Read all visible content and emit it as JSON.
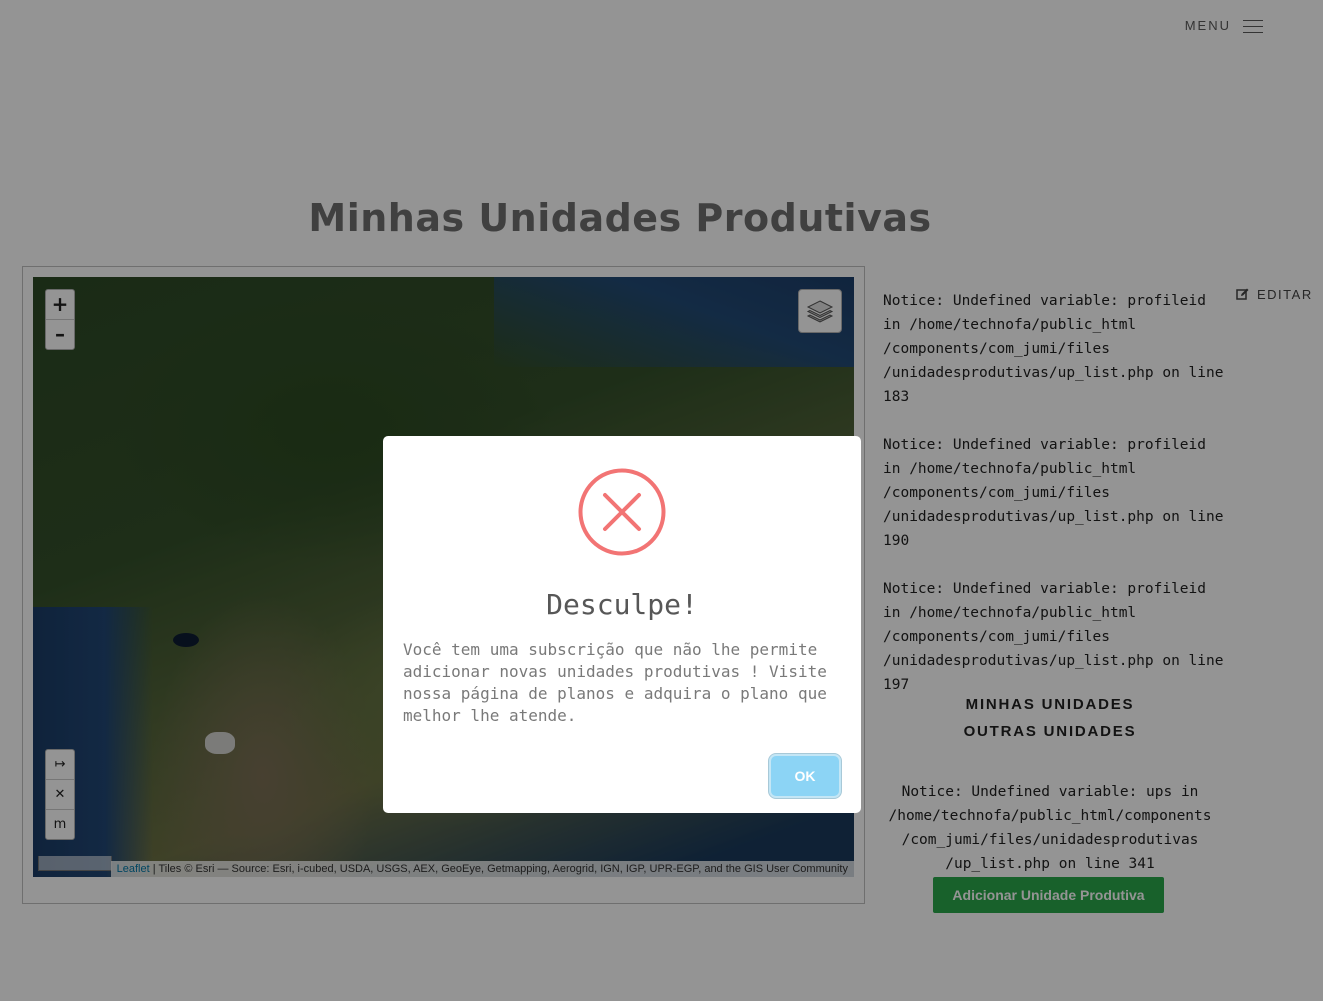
{
  "header": {
    "menu_label": "MENU",
    "menu_icon": "hamburger-icon"
  },
  "page_title": "Minhas Unidades Produtivas",
  "map": {
    "zoom_in": "+",
    "zoom_out": "–",
    "layers_icon": "layers-icon",
    "measure_buttons": [
      "↦",
      "✕",
      "m"
    ],
    "attribution_link": "Leaflet",
    "attribution_text": " | Tiles © Esri — Source: Esri, i-cubed, USDA, USGS, AEX, GeoEye, Getmapping, Aerogrid, IGN, IGP, UPR-EGP, and the GIS User Community"
  },
  "sidebar": {
    "notices": [
      "Notice: Undefined variable: profileid\nin /home/technofa/public_html\n/components/com_jumi/files\n/unidadesprodutivas/up_list.php on line\n183",
      "Notice: Undefined variable: profileid\nin /home/technofa/public_html\n/components/com_jumi/files\n/unidadesprodutivas/up_list.php on line\n190",
      "Notice: Undefined variable: profileid\nin /home/technofa/public_html\n/components/com_jumi/files\n/unidadesprodutivas/up_list.php on line\n197"
    ],
    "edit_label": "EDITAR",
    "nav_mine": "MINHAS UNIDADES",
    "nav_other": "OUTRAS UNIDADES",
    "bottom_notice": "Notice: Undefined variable: ups in /home/technofa/public_html/components /com_jumi/files/unidadesprodutivas /up_list.php on line 341",
    "add_button": "Adicionar Unidade Produtiva"
  },
  "modal": {
    "icon": "error-x-icon",
    "title": "Desculpe!",
    "text": "Você tem uma subscrição que não lhe permite adicionar novas unidades produtivas ! Visite nossa página de planos e adquira o plano que melhor lhe atende.",
    "ok_label": "OK"
  },
  "colors": {
    "error": "#f27474",
    "ok_button": "#8cd4f5",
    "add_button": "#2aa74a"
  }
}
